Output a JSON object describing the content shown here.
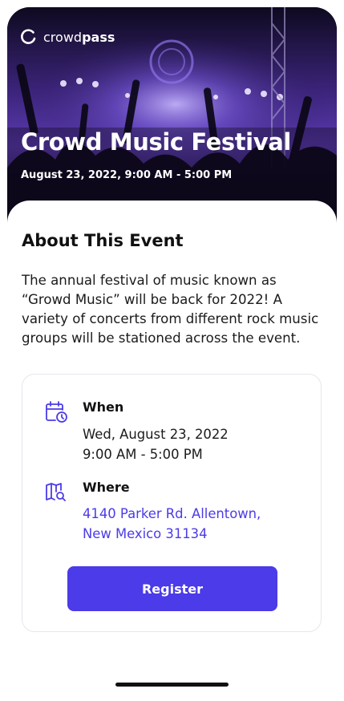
{
  "brand": {
    "name_prefix": "crowd",
    "name_suffix": "pass"
  },
  "event": {
    "title": "Crowd Music Festival",
    "datetime": "August 23, 2022, 9:00 AM - 5:00 PM"
  },
  "about": {
    "heading": "About This Event",
    "description": "The annual festival of music known as “Growd Music” will be back for 2022! A variety of concerts from different rock music groups will be stationed across the event."
  },
  "details": {
    "when_label": "When",
    "when_date": "Wed, August 23, 2022",
    "when_time": "9:00 AM - 5:00 PM",
    "where_label": "Where",
    "where_line1": "4140 Parker Rd. Allentown,",
    "where_line2": "New Mexico 31134"
  },
  "actions": {
    "register_label": "Register"
  },
  "icons": {
    "when": "calendar-clock-icon",
    "where": "map-search-icon",
    "brand": "crowdpass-logo-icon"
  },
  "colors": {
    "accent": "#4b3be8",
    "hero_overlay": "#2a1656"
  }
}
